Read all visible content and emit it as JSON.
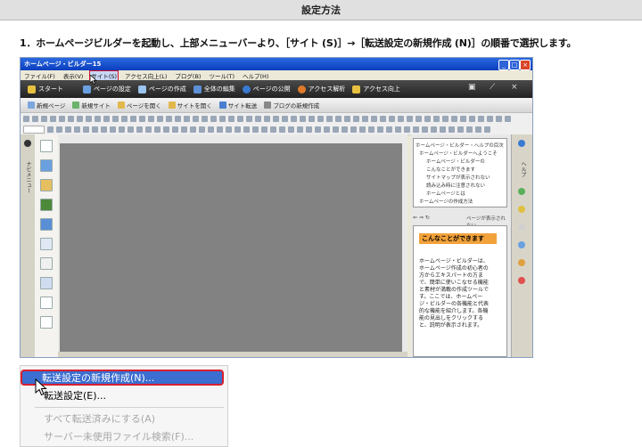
{
  "header": {
    "title": "設定方法"
  },
  "instruction": "1．ホームページビルダーを起動し、上部メニューバーより、［サイト (S)］→［転送設定の新規作成 (N)］の順番で選択します。",
  "app": {
    "title": "ホームページ・ビルダー15",
    "menu": [
      "ファイル(F)",
      "表示(V)",
      "サイト(S)",
      "アクセス向上(L)",
      "ブログ(B)",
      "ツール(T)",
      "ヘルプ(H)"
    ],
    "highlighted_menu": "サイト(S)",
    "nav_buttons": [
      "スタート",
      "ページの設定",
      "ページの作成",
      "全体の編集",
      "ページの公開",
      "アクセス解析",
      "アクセス向上"
    ],
    "toolbar_buttons": [
      "新規ページ",
      "新規サイト",
      "ページを開く",
      "サイトを開く",
      "サイト転送",
      "ブログの新規作成"
    ],
    "left_tab": "ナビメニュー",
    "right_tab": "ヘルプ",
    "tree_items": [
      "ホームページ・ビルダー・ヘルプの目次",
      "ホームページ・ビルダーへようこそ",
      "ホームページ・ビルダーの",
      "こんなことができます",
      "サイトマップが表示されない",
      "読み込み時に注意されない",
      "ホームページとは",
      "ホームページの作成方法"
    ],
    "help_nav": "ページが表示されない",
    "help_heading": "こんなことができます",
    "help_text": "ホームページ・ビルダーは、ホームページ作成の初心者の方からエキスパートの方まで、簡単に使いこなせる機能と素材が満載の作成ツールです。ここでは、ホームページ・ビルダーの各機能と代表的な機能を紹介します。各機能の見出しをクリックすると、説明が表示されます。"
  },
  "context_menu": {
    "items": [
      {
        "label": "転送設定の新規作成(N)...",
        "state": "selected"
      },
      {
        "label": "転送設定(E)...",
        "state": "normal"
      },
      {
        "label": "すべて転送済みにする(A)",
        "state": "disabled"
      },
      {
        "label": "サーバー未使用ファイル検索(F)...",
        "state": "disabled"
      }
    ]
  },
  "colors": {
    "highlight_border": "#d9202e",
    "selection": "#3b6ed0",
    "help_heading": "#f2a23a"
  }
}
